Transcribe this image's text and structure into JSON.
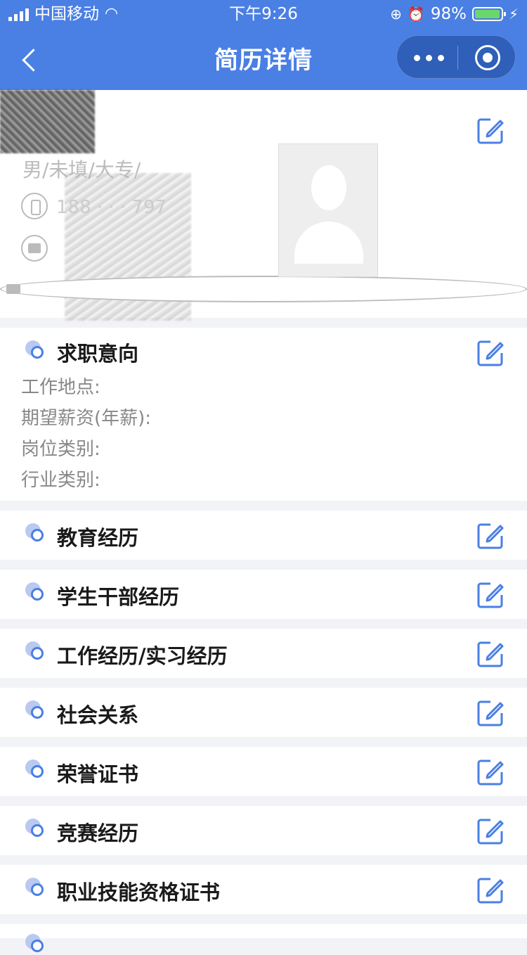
{
  "status": {
    "carrier": "中国移动",
    "time": "下午9:26",
    "battery": "98%",
    "battery_level": 0.98
  },
  "nav": {
    "title": "简历详情"
  },
  "profile": {
    "info": "男/未填/大专/",
    "phone": "188  ·  ·  ·  797"
  },
  "intention": {
    "title": "求职意向",
    "fields": [
      "工作地点:",
      "期望薪资(年薪):",
      "岗位类别:",
      "行业类别:"
    ]
  },
  "sections": [
    {
      "title": "教育经历"
    },
    {
      "title": "学生干部经历"
    },
    {
      "title": "工作经历/实习经历"
    },
    {
      "title": "社会关系"
    },
    {
      "title": "荣誉证书"
    },
    {
      "title": "竞赛经历"
    },
    {
      "title": "职业技能资格证书"
    }
  ],
  "colors": {
    "accent": "#4a7fe4",
    "capsule": "#2f5fb8",
    "battery_fill": "#6bd66b"
  },
  "icons": {
    "edit": "edit-icon",
    "section": "section-bullet-icon"
  }
}
